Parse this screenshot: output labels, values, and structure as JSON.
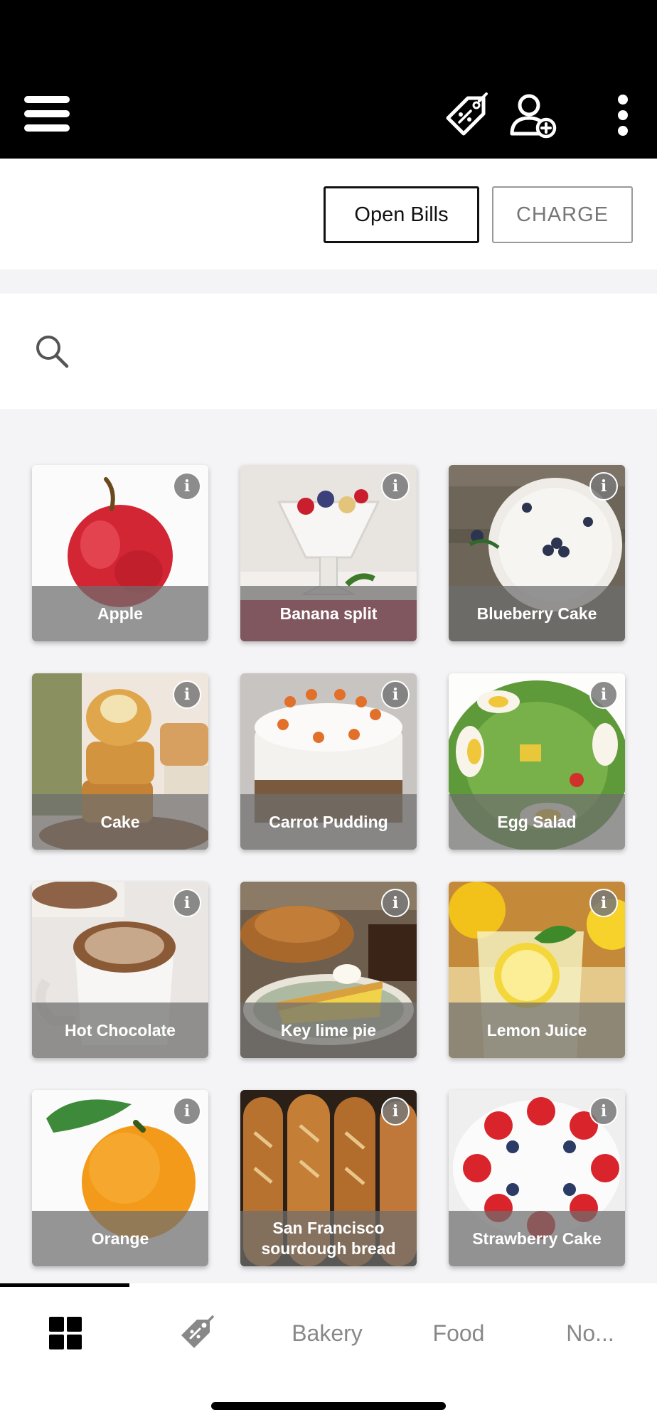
{
  "header": {
    "menu_icon": "hamburger-menu-icon",
    "discount_icon": "price-tag-icon",
    "customer_icon": "add-customer-icon",
    "more_icon": "vertical-dots-icon"
  },
  "actions": {
    "open_bills_label": "Open Bills",
    "charge_label": "CHARGE"
  },
  "search": {
    "icon": "search-icon",
    "value": "",
    "placeholder": ""
  },
  "products": [
    {
      "name": "Apple"
    },
    {
      "name": "Banana split"
    },
    {
      "name": "Blueberry Cake"
    },
    {
      "name": "Cake"
    },
    {
      "name": "Carrot Pudding"
    },
    {
      "name": "Egg Salad"
    },
    {
      "name": "Hot Chocolate"
    },
    {
      "name": "Key lime pie"
    },
    {
      "name": "Lemon Juice"
    },
    {
      "name": "Orange"
    },
    {
      "name": "San Francisco sourdough bread"
    },
    {
      "name": "Strawberry Cake"
    }
  ],
  "info_glyph": "i",
  "bottom_nav": {
    "tabs": [
      {
        "icon": "grid-icon"
      },
      {
        "icon": "discount-tag-icon"
      },
      {
        "label": "Bakery"
      },
      {
        "label": "Food"
      },
      {
        "label": "No..."
      }
    ]
  },
  "colors": {
    "header_bg": "#000000",
    "accent": "#111111"
  }
}
